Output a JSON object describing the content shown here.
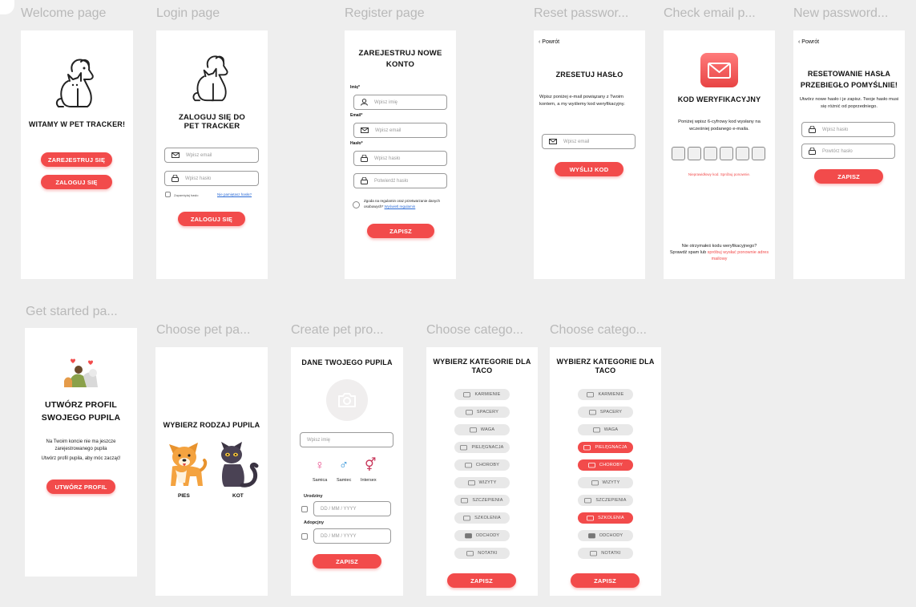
{
  "labels": {
    "welcome": "Welcome page",
    "login": "Login page",
    "register": "Register page",
    "reset": "Reset passwor...",
    "check": "Check email p...",
    "newpass": "New password...",
    "getstarted": "Get started pa...",
    "choosepet": "Choose pet pa...",
    "createpet": "Create pet pro...",
    "choosecat1": "Choose catego...",
    "choosecat2": "Choose catego..."
  },
  "colors": {
    "accent": "#f24b4b",
    "link": "#2b6bd6",
    "frame_bg": "#ffffff",
    "canvas_bg": "#eeeeee"
  },
  "welcome": {
    "title": "WITAMY W PET TRACKER!",
    "register_btn": "ZAREJESTRUJ SIĘ",
    "login_btn": "ZALOGUJ SIĘ",
    "icon": "dog-cat-outline-icon"
  },
  "login": {
    "title": "ZALOGUJ SIĘ DO PET TRACKER",
    "email_placeholder": "Wpisz email",
    "password_placeholder": "Wpisz hasło",
    "remember": "Zapamiętaj hasło",
    "forgot": "Nie pamiętasz hasła?",
    "submit": "ZALOGUJ SIĘ"
  },
  "register": {
    "title": "ZAREJESTRUJ NOWE KONTO",
    "name_label": "Imię*",
    "name_placeholder": "Wpisz imię",
    "email_label": "Email*",
    "email_placeholder": "Wpisz email",
    "password_label": "Hasło*",
    "password_placeholder": "Wpisz hasło",
    "confirm_placeholder": "Potwierdź hasło",
    "consent": "Zgoda na regulamin oraz przetwarzanie danych osobowych*",
    "consent_link": "Wyświetl regulamin",
    "submit": "ZAPISZ"
  },
  "reset": {
    "back": "Powrót",
    "title": "ZRESETUJ HASŁO",
    "description": "Wpisz poniżej e-mail powiązany z Twoim kontem, a my wyślemy kod weryfikacyjny.",
    "email_placeholder": "Wpisz email",
    "submit": "WYŚLIJ KOD"
  },
  "check": {
    "title": "KOD WERYFIKACYJNY",
    "description": "Poniżej wpisz 6-cyfrowy kod wysłany na wcześniej podanego e-maila.",
    "error": "Nieprawidłowy kod. Spróbuj ponownie.",
    "footer_q": "Nie otrzymałeś kodu weryfikacyjnego?",
    "footer_prefix": "Sprawdź spam lub",
    "footer_link": "spróbuj wysłać ponownie adres mailowy"
  },
  "newpass": {
    "back": "Powrót",
    "title": "RESETOWANIE HASŁA PRZEBIEGŁO POMYŚLNIE!",
    "description": "Utwórz nowe hasło i je zapisz. Twoje hasło musi się różnić od poprzedniego.",
    "password_placeholder": "Wpisz hasło",
    "confirm_placeholder": "Powtórz hasło",
    "submit": "ZAPISZ"
  },
  "getstarted": {
    "title": "UTWÓRZ PROFIL SWOJEGO PUPILA",
    "line1": "Na Twoim koncie nie ma jeszcze",
    "line2": "zarejestrowanego pupila",
    "line3": "Utwórz profil pupila, aby móc zacząć!",
    "submit": "UTWÓRZ PROFIL"
  },
  "choosepet": {
    "title": "WYBIERZ RODZAJ PUPILA",
    "dog": "PIES",
    "cat": "KOT"
  },
  "createpet": {
    "title": "DANE TWOJEGO PUPILA",
    "name_placeholder": "Wpisz imię",
    "female": "Samica",
    "male": "Samiec",
    "intersex": "Intersex",
    "birthday": "Urodziny",
    "adoption": "Adopcjny",
    "date_placeholder": "DD / MM / YYYY",
    "submit": "ZAPISZ"
  },
  "categories": {
    "title": "WYBIERZ KATEGORIE DLA TACO",
    "items": [
      "KARMIENIE",
      "SPACERY",
      "WAGA",
      "PIELĘGNACJA",
      "CHOROBY",
      "WIZYTY",
      "SZCZEPIENIA",
      "SZKOLENIA",
      "ODCHODY",
      "NOTATKI"
    ],
    "active_second": [
      "PIELĘGNACJA",
      "CHOROBY",
      "SZKOLENIA"
    ],
    "submit": "ZAPISZ"
  }
}
